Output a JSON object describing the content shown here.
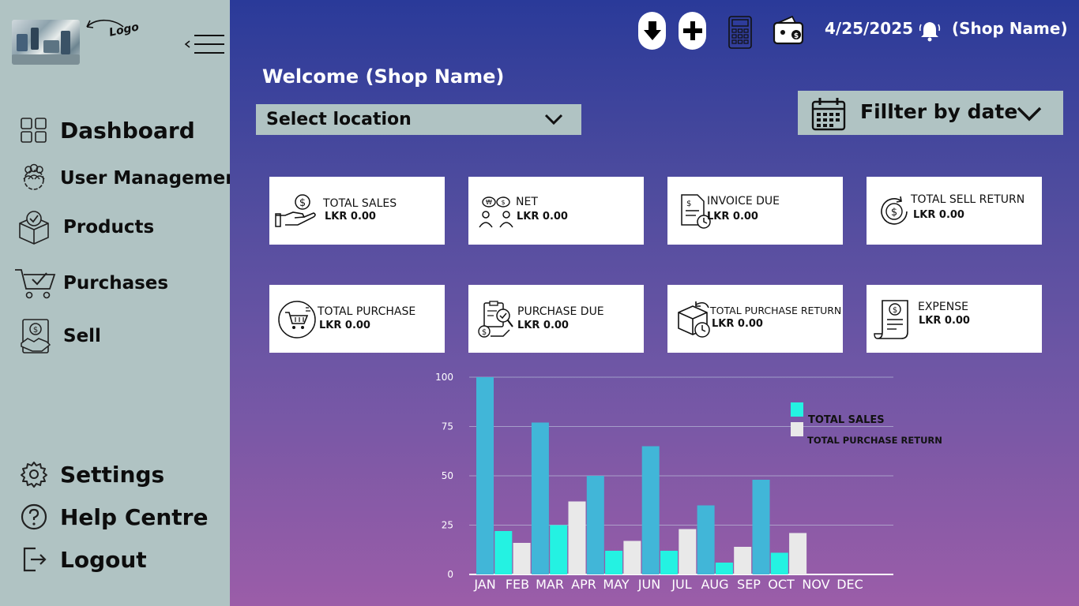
{
  "sidebar": {
    "logo_note": "Logo",
    "nav": [
      {
        "label": "Dashboard"
      },
      {
        "label": "User Management"
      },
      {
        "label": "Products"
      },
      {
        "label": "Purchases"
      },
      {
        "label": "Sell"
      }
    ],
    "bottom": [
      {
        "label": "Settings"
      },
      {
        "label": "Help Centre"
      },
      {
        "label": "Logout"
      }
    ]
  },
  "header": {
    "date": "4/25/2025",
    "shop_name": "(Shop Name)",
    "icons": [
      "download-icon",
      "plus-icon",
      "calculator-icon",
      "wallet-icon",
      "bell-icon"
    ]
  },
  "main": {
    "welcome": "Welcome (Shop Name)",
    "location_select": "Select location",
    "date_filter": "Fillter by date"
  },
  "cards": [
    {
      "title": "TOTAL SALES",
      "value": "LKR 0.00",
      "icon": "hand-coin-icon"
    },
    {
      "title": "NET",
      "value": "LKR 0.00",
      "icon": "exchange-icon"
    },
    {
      "title": "INVOICE DUE",
      "value": "LKR 0.00",
      "icon": "invoice-clock-icon"
    },
    {
      "title": "TOTAL SELL RETURN",
      "value": "LKR 0.00",
      "icon": "refund-icon"
    },
    {
      "title": "TOTAL PURCHASE",
      "value": "LKR 0.00",
      "icon": "cart-icon"
    },
    {
      "title": "PURCHASE DUE",
      "value": "LKR 0.00",
      "icon": "purchase-due-icon"
    },
    {
      "title": "TOTAL PURCHASE RETURN",
      "value": "LKR 0.00",
      "icon": "box-return-icon"
    },
    {
      "title": "EXPENSE",
      "value": "LKR 0.00",
      "icon": "receipt-icon"
    }
  ],
  "colors": {
    "sidebar_bg": "#b0c3c3",
    "bar_blue": "#41b6d8",
    "bar_cyan": "#24f2e2",
    "bar_white": "#e9e9e9"
  },
  "chart_data": {
    "type": "bar",
    "categories": [
      "JAN",
      "FEB",
      "MAR",
      "APR",
      "MAY",
      "JUN",
      "JUL",
      "AUG",
      "SEP",
      "OCT",
      "NOV",
      "DEC"
    ],
    "ylim": [
      0,
      100
    ],
    "yticks": [
      "0",
      "25",
      "50",
      "75",
      "100"
    ],
    "grid": true,
    "legend_position": "top-right",
    "legend": [
      "TOTAL SALES",
      "TOTAL PURCHASE RETURN"
    ],
    "bars": [
      {
        "value": 100,
        "color": "#41b6d8"
      },
      {
        "value": 22,
        "color": "#24f2e2"
      },
      {
        "value": 16,
        "color": "#e9e9e9"
      },
      {
        "value": 77,
        "color": "#41b6d8"
      },
      {
        "value": 25,
        "color": "#24f2e2"
      },
      {
        "value": 37,
        "color": "#e9e9e9"
      },
      {
        "value": 50,
        "color": "#41b6d8"
      },
      {
        "value": 12,
        "color": "#24f2e2"
      },
      {
        "value": 17,
        "color": "#e9e9e9"
      },
      {
        "value": 65,
        "color": "#41b6d8"
      },
      {
        "value": 12,
        "color": "#24f2e2"
      },
      {
        "value": 23,
        "color": "#e9e9e9"
      },
      {
        "value": 35,
        "color": "#41b6d8"
      },
      {
        "value": 6,
        "color": "#24f2e2"
      },
      {
        "value": 14,
        "color": "#e9e9e9"
      },
      {
        "value": 48,
        "color": "#41b6d8"
      },
      {
        "value": 11,
        "color": "#24f2e2"
      },
      {
        "value": 21,
        "color": "#e9e9e9"
      }
    ]
  }
}
